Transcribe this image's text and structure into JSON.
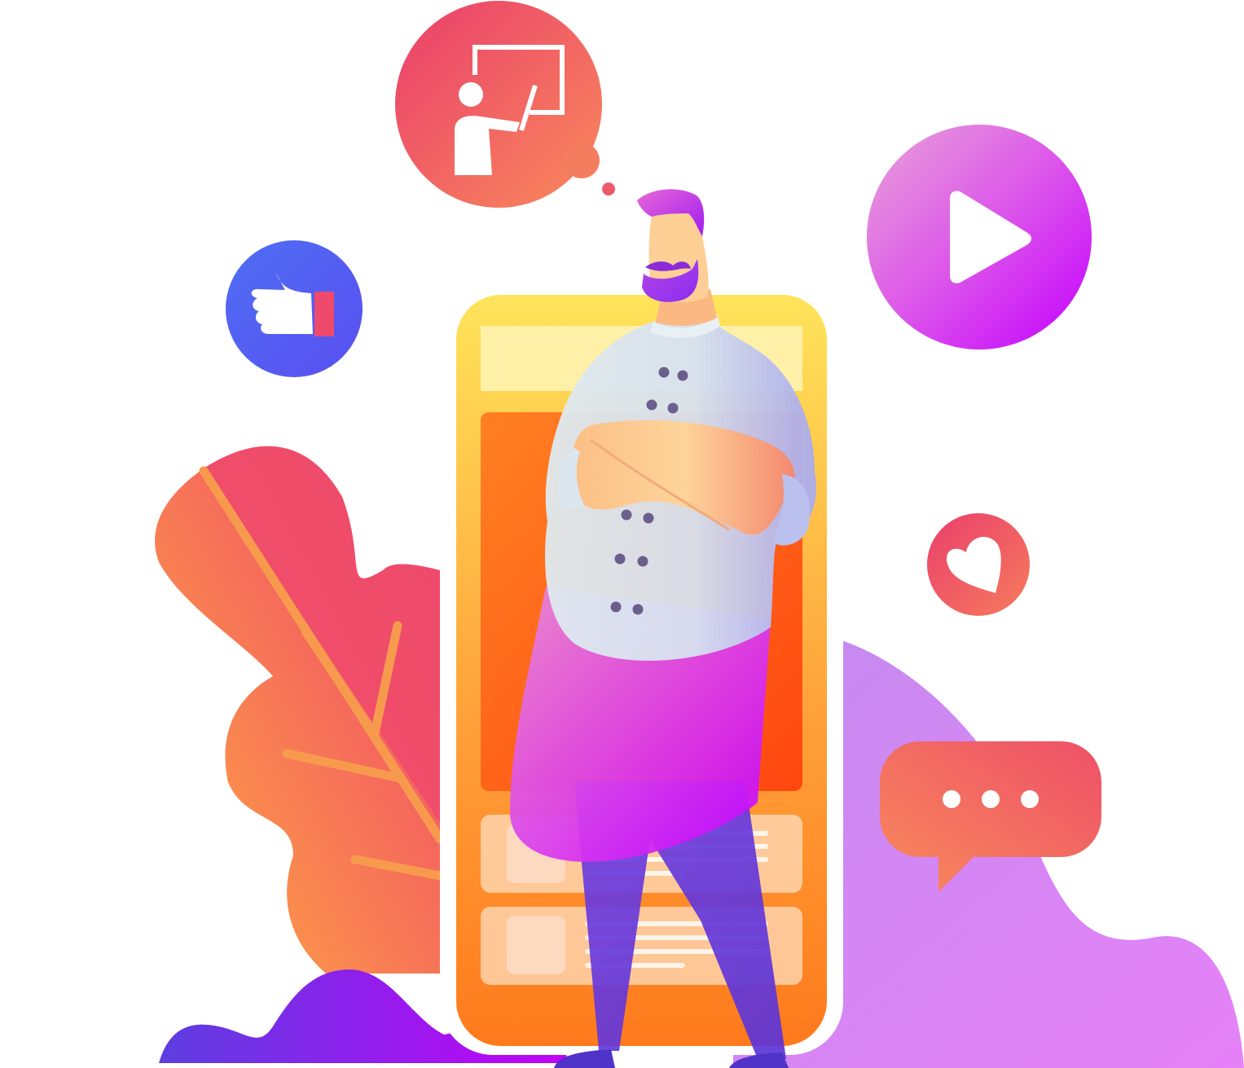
{
  "illustration": {
    "subject": "chef-with-smartphone-social-media",
    "icons": [
      {
        "name": "presentation-teacher-icon",
        "bubble": "thought-bubble"
      },
      {
        "name": "thumbs-up-icon",
        "bubble": "circle"
      },
      {
        "name": "play-icon",
        "bubble": "circle"
      },
      {
        "name": "heart-icon",
        "bubble": "circle"
      },
      {
        "name": "chat-ellipsis-icon",
        "bubble": "speech-bubble"
      }
    ],
    "colors": {
      "orange": "#ff8a1e",
      "pink": "#ee4470",
      "coral": "#f77c5f",
      "purple": "#c300ff",
      "violet": "#7b2ff7",
      "blue": "#5160f0",
      "lavender": "#c98bf0",
      "yellow": "#ffe45c",
      "skin": "#fcd49a",
      "shirt": "#dde8ee"
    }
  }
}
